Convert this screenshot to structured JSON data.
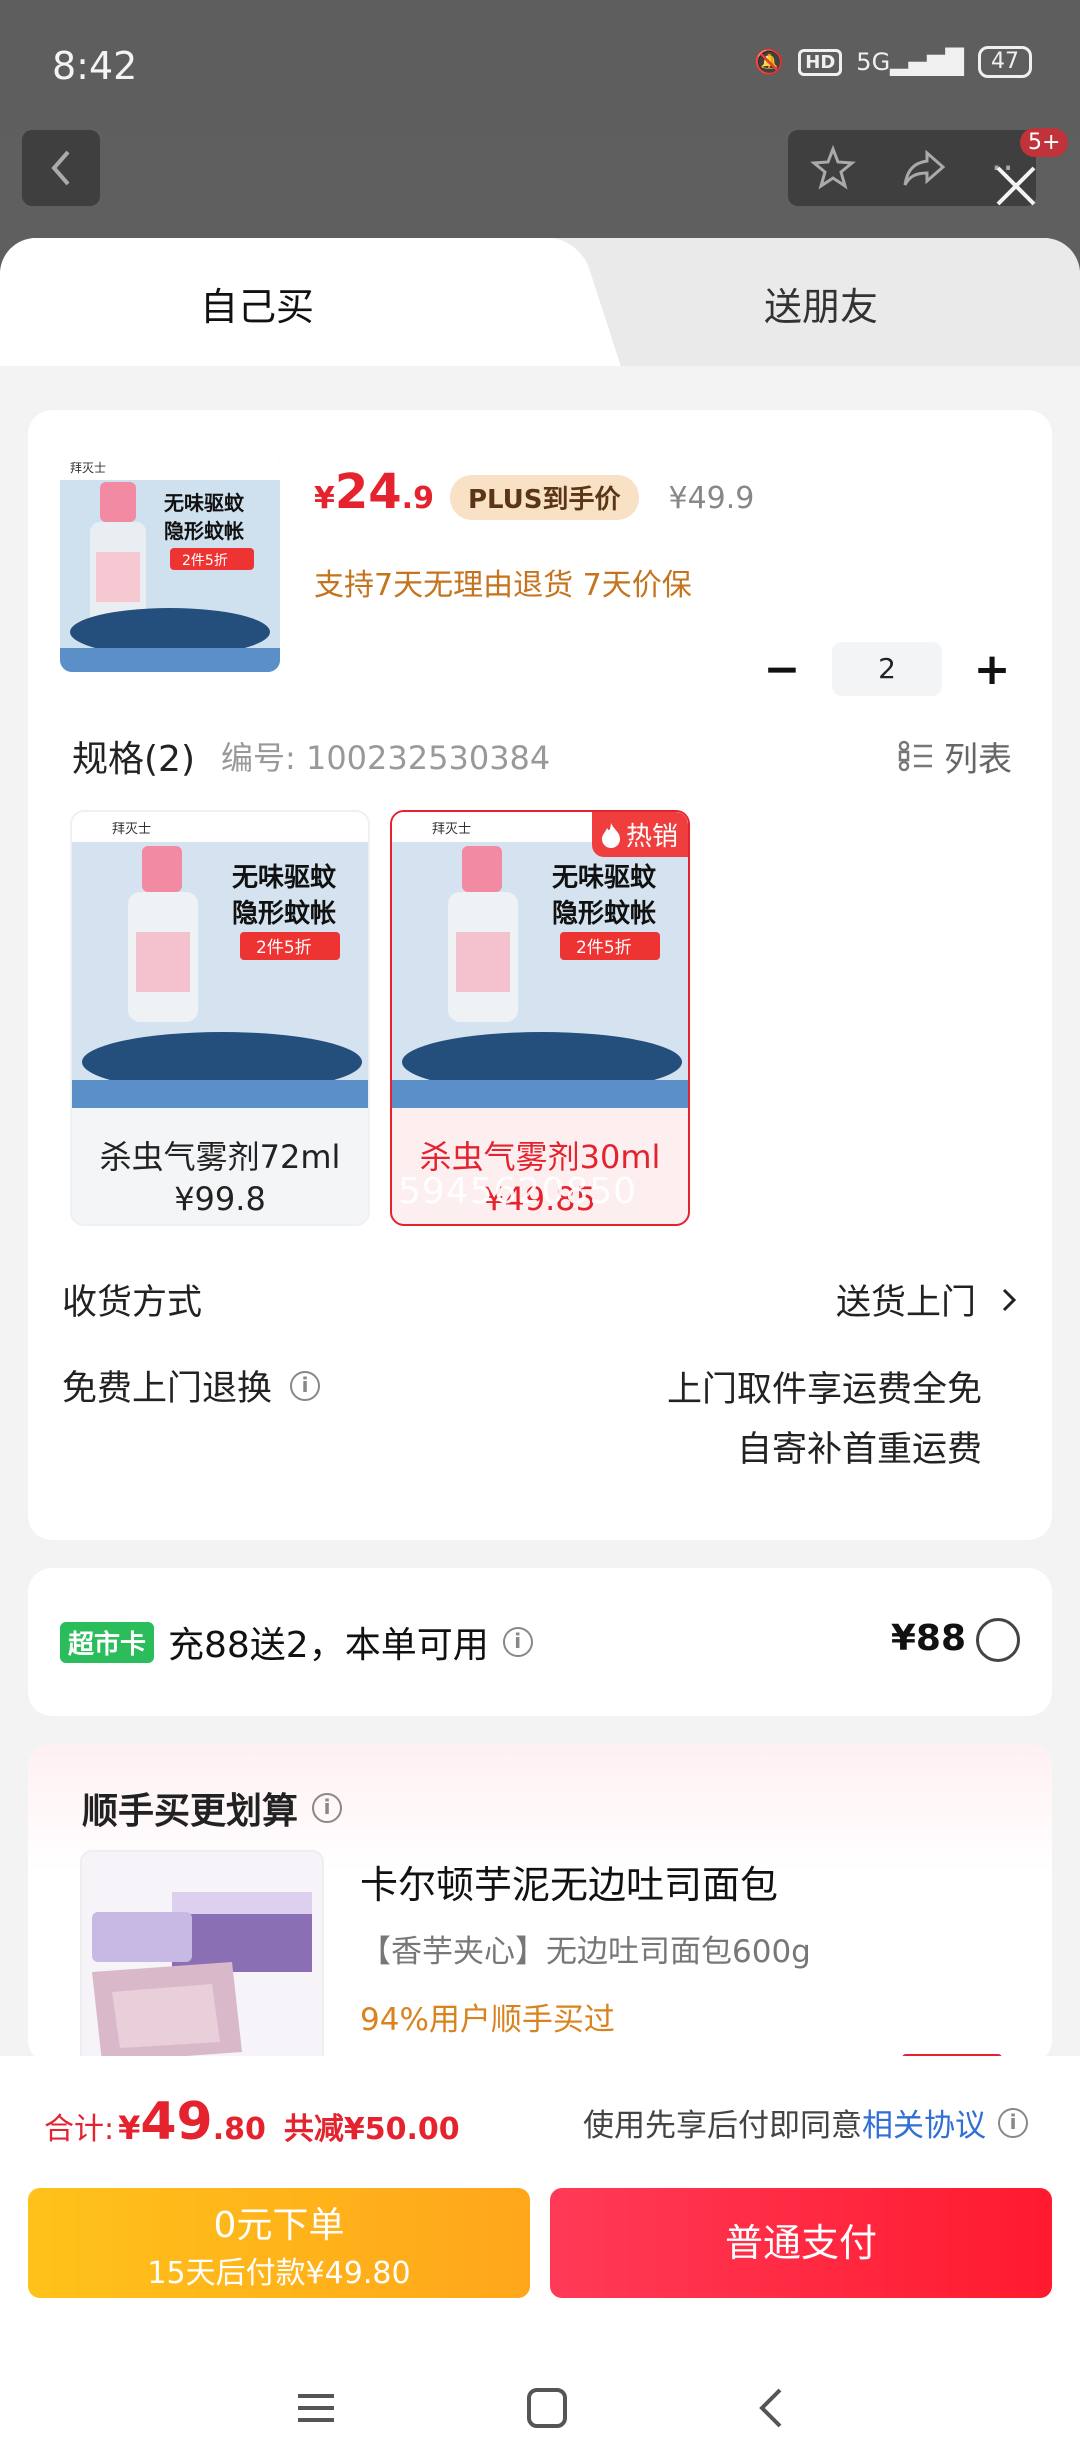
{
  "status": {
    "time": "8:42",
    "signal": "5G",
    "battery": "47"
  },
  "background": {
    "notif_badge": "5+"
  },
  "tabs": {
    "self": "自己买",
    "friend": "送朋友"
  },
  "product": {
    "price_symbol": "¥",
    "price_int": "24",
    "price_dec": ".9",
    "plus_tag": "PLUS到手价",
    "original_price": "¥49.9",
    "guarantee": "支持7天无理由退货  7天价保",
    "quantity": "2",
    "spec_title": "规格(2)",
    "spec_no": "编号: 100232530384",
    "list_label": "列表",
    "image_texts": {
      "brand": "拜灭士",
      "line1": "无味驱蚊",
      "line2": "隐形蚊帐",
      "promo": "2件5折"
    }
  },
  "variants": [
    {
      "name": "杀虫气雾剂72ml",
      "price": "¥99.8",
      "selected": false,
      "hot": ""
    },
    {
      "name": "杀虫气雾剂30ml",
      "price": "¥49.85",
      "selected": true,
      "hot": "热销",
      "watermark": "5945620850"
    }
  ],
  "shipping": {
    "label": "收货方式",
    "value": "送货上门"
  },
  "returns": {
    "label": "免费上门退换",
    "line1": "上门取件享运费全免",
    "line2": "自寄补首重运费"
  },
  "market": {
    "tag": "超市卡",
    "text": "充88送2，本单可用",
    "price": "¥88"
  },
  "bundle": {
    "title": "顺手买更划算",
    "name": "卡尔顿芋泥无边吐司面包",
    "desc": "【香芋夹心】无边吐司面包600g",
    "stat": "94%用户顺手买过"
  },
  "checkout": {
    "total_label": "合计:",
    "total_sym": "¥",
    "total_int": "49",
    "total_dec": ".80",
    "discount": "共减¥50.00",
    "agree_text": "使用先享后付即同意",
    "agree_link": "相关协议",
    "later_line1": "0元下单",
    "later_line2": "15天后付款¥49.80",
    "pay_label": "普通支付"
  },
  "colors": {
    "accent_red": "#e4232f",
    "market_green": "#2bbc5c",
    "pay_yellow": "#ffb21a",
    "link_blue": "#2f6fd6"
  }
}
